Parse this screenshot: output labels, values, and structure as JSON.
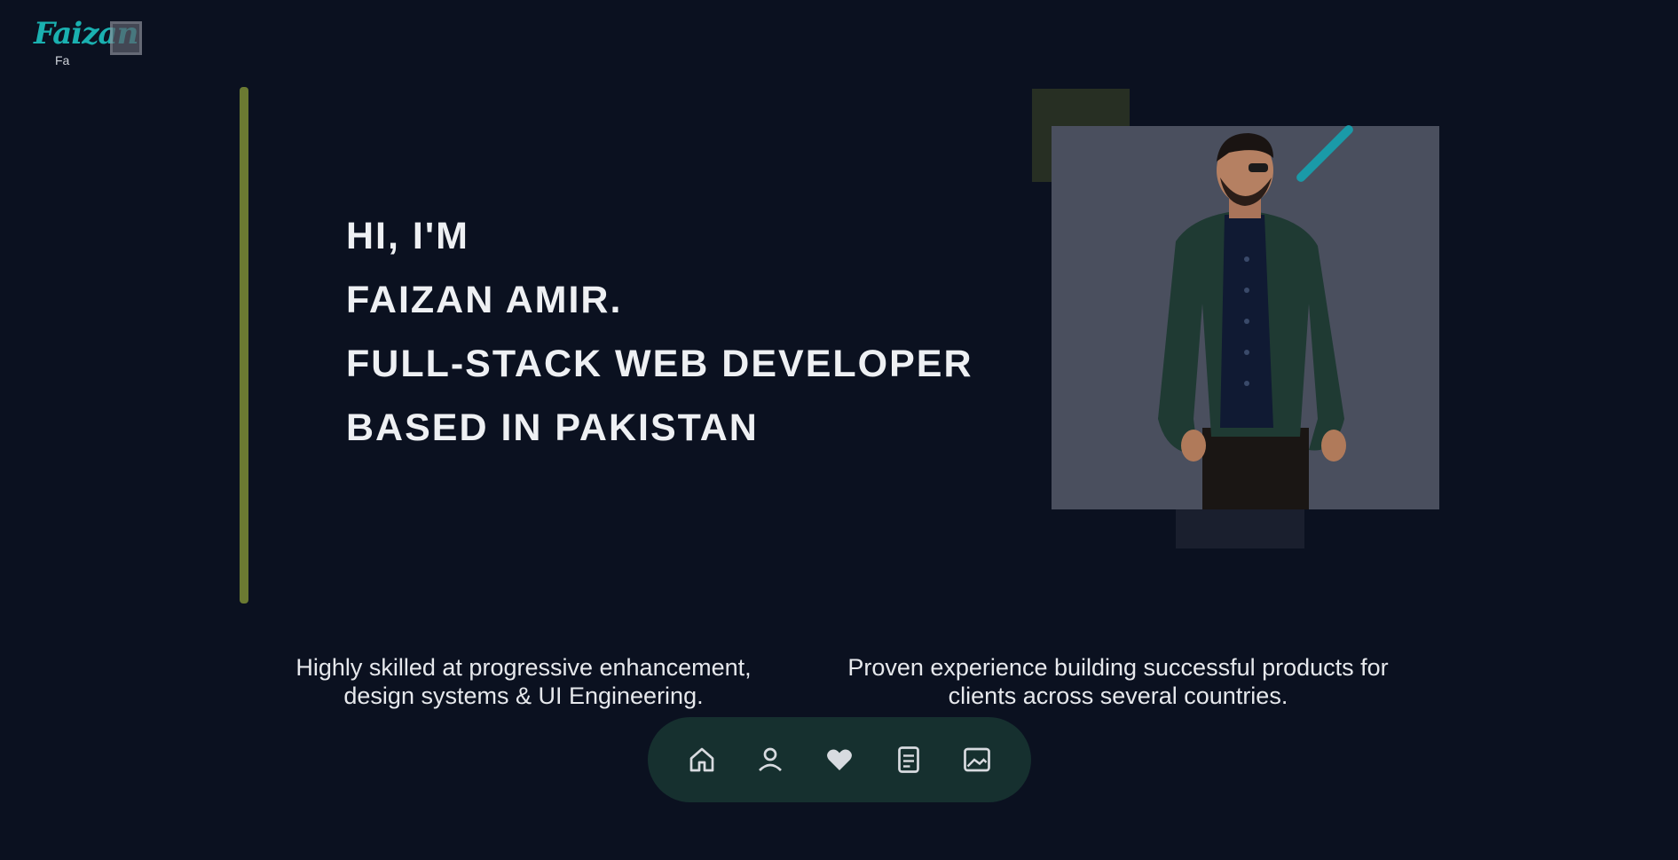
{
  "logo": {
    "script_text": "Faizan",
    "sub_text": "Fa"
  },
  "hero": {
    "line1": "HI, I'M",
    "line2": "FAIZAN AMIR.",
    "line3": "FULL-STACK WEB DEVELOPER",
    "line4": "BASED IN PAKISTAN"
  },
  "descriptions": {
    "left": "Highly skilled at progressive enhancement, design systems & UI Engineering.",
    "right": "Proven experience building successful products for clients across several countries."
  },
  "dock": {
    "items": [
      {
        "icon": "home-icon"
      },
      {
        "icon": "user-icon"
      },
      {
        "icon": "heart-icon"
      },
      {
        "icon": "document-icon"
      },
      {
        "icon": "image-icon"
      }
    ]
  },
  "colors": {
    "background": "#0b1120",
    "accent_teal": "#1ab0b0",
    "accent_olive": "#6b7a32",
    "dock_bg": "#16302f",
    "photo_bg": "#4a4f5e"
  }
}
